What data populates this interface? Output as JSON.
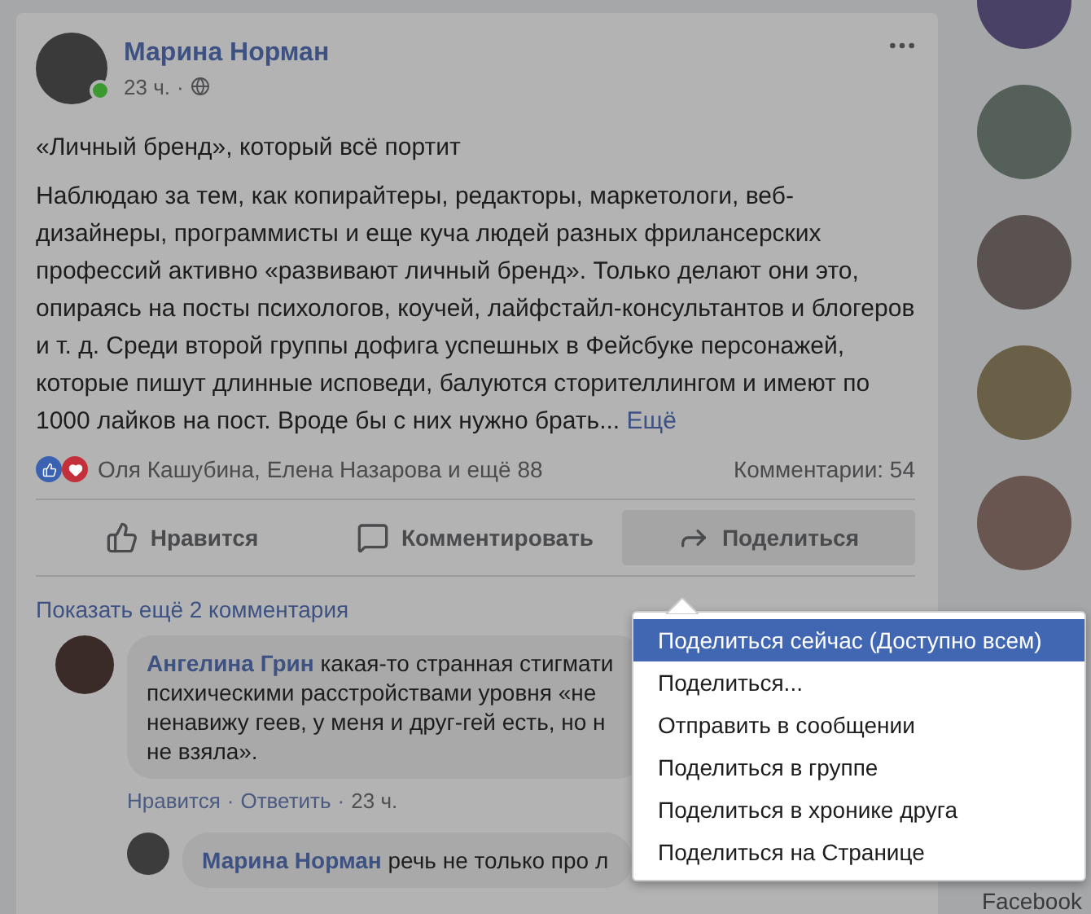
{
  "post": {
    "author": "Марина Норман",
    "time": "23 ч.",
    "separator": "·",
    "online": true,
    "title": "«Личный бренд», который всё портит",
    "body": "Наблюдаю за тем, как копирайтеры, редакторы, маркетологи, веб-дизайнеры, программисты и еще куча людей разных фрилансерских профессий активно «развивают личный бренд». Только делают они это, опираясь на посты психологов, коучей, лайфстайл-консультантов и блогеров и т. д. Среди второй группы дофига успешных в Фейсбуке персонажей, которые пишут длинные исповеди, балуются сторителлингом и имеют по 1000 лайков на пост. Вроде бы с них нужно брать...",
    "more": "Ещё",
    "reactions": "Оля Кашубина, Елена Назарова и ещё 88",
    "comments_count": "Комментарии: 54",
    "actions": [
      {
        "kind": "like",
        "label": "Нравится",
        "selected": false
      },
      {
        "kind": "comment",
        "label": "Комментировать",
        "selected": false
      },
      {
        "kind": "share",
        "label": "Поделиться",
        "selected": true
      }
    ]
  },
  "show_more": "Показать ещё 2 комментария",
  "comments": [
    {
      "author": "Ангелина Грин",
      "lines": [
        "какая-то странная стигмати",
        "психическими расстройствами уровня «не",
        "ненавижу геев, у меня и друг-гей есть, но н",
        "не взяла»."
      ],
      "meta": [
        "Нравится",
        "Ответить",
        "23 ч."
      ],
      "meta_separator": "·",
      "reply": false
    },
    {
      "author": "Марина Норман",
      "lines": [
        "речь не только про л"
      ],
      "reply": true
    }
  ],
  "share_menu": [
    {
      "label": "Поделиться сейчас (Доступно всем)",
      "selected": true
    },
    {
      "label": "Поделиться...",
      "selected": false
    },
    {
      "label": "Отправить в сообщении",
      "selected": false
    },
    {
      "label": "Поделиться в группе",
      "selected": false
    },
    {
      "label": "Поделиться в хронике друга",
      "selected": false
    },
    {
      "label": "Поделиться на Странице",
      "selected": false
    }
  ],
  "sidebar_footer": "Facebook"
}
